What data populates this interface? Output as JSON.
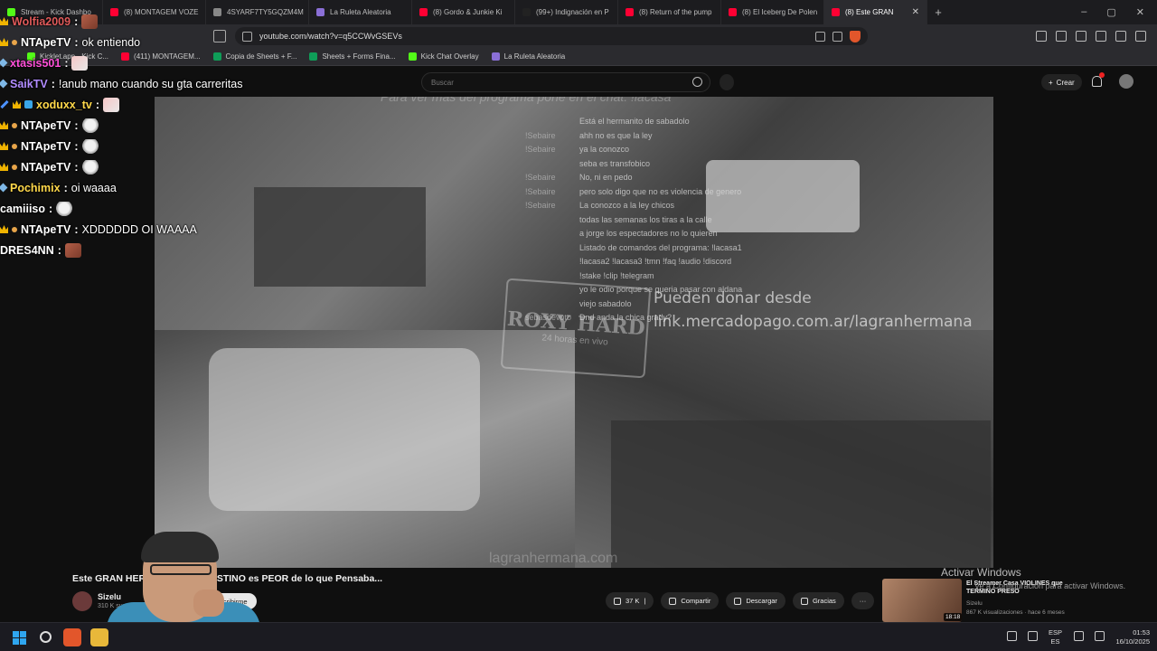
{
  "browser": {
    "tabs": [
      {
        "label": "Stream - Kick Dashbo",
        "color": "#53fc18"
      },
      {
        "label": "(8) MONTAGEM VOZE",
        "color": "#ff0033"
      },
      {
        "label": "4SYARF7TY5GQZM4M",
        "color": "#888888"
      },
      {
        "label": "La Ruleta Aleatoria",
        "color": "#8a6fd6"
      },
      {
        "label": "(8) Gordo & Junkie Ki",
        "color": "#ff0033"
      },
      {
        "label": "(99+) Indignación en P",
        "color": "#222222"
      },
      {
        "label": "(8) Return of the pump",
        "color": "#ff0033"
      },
      {
        "label": "(8) El Iceberg De Polen",
        "color": "#ff0033"
      },
      {
        "label": "(8) Este GRAN",
        "color": "#ff0033",
        "active": true
      }
    ],
    "new_tab_label": "Nueva pestaña",
    "url": "youtube.com/watch?v=q5CCWvGSEVs",
    "bookmarks": [
      {
        "label": "Kicklet.app - Kick C...",
        "color": "#53fc18"
      },
      {
        "label": "(411) MONTAGEM...",
        "color": "#ff0033"
      },
      {
        "label": "Copia de Sheets + F...",
        "color": "#0f9d58"
      },
      {
        "label": "Sheets + Forms Fina...",
        "color": "#0f9d58"
      },
      {
        "label": "Kick Chat Overlay",
        "color": "#53fc18"
      },
      {
        "label": "La Ruleta Aleatoria",
        "color": "#8a6fd6"
      }
    ]
  },
  "youtube": {
    "search_placeholder": "Buscar",
    "create_label": "Crear",
    "notification_count": "9"
  },
  "video": {
    "top_banner": "Para ver más del programa pone en el chat: !lacasa",
    "overlay_chat": [
      {
        "user": "",
        "text": "Está el hermanito de sabadolo"
      },
      {
        "user": "!Sebaire",
        "text": "ahh no es que la ley"
      },
      {
        "user": "!Sebaire",
        "text": "ya la conozco"
      },
      {
        "user": "",
        "text": "seba es transfobico"
      },
      {
        "user": "!Sebaire",
        "text": "No, ni en pedo"
      },
      {
        "user": "!Sebaire",
        "text": "pero solo digo que no es violencia de genero"
      },
      {
        "user": "!Sebaire",
        "text": "La conozco a la ley chicos"
      },
      {
        "user": "",
        "text": "todas las semanas los tiras a la calle"
      },
      {
        "user": "",
        "text": "a jorge los espectadores no lo quieren"
      },
      {
        "user": "",
        "text": "Listado de comandos del programa: !lacasa1"
      },
      {
        "user": "",
        "text": "!lacasa2 !lacasa3 !tmn !faq !audio !discord"
      },
      {
        "user": "",
        "text": "!stake !clip !telegram"
      },
      {
        "user": "",
        "text": "yo le odio porque se queria pasar con aldana"
      },
      {
        "user": "",
        "text": "viejo sabadolo"
      },
      {
        "user": "sebasdevoto",
        "text": "Dnd anda la chica grady?"
      }
    ],
    "stamp_title": "ROXY HARD",
    "stamp_sub": "24 horas en vivo",
    "donate_line1": "Pueden donar desde",
    "donate_line2": "link.mercadopago.com.ar/lagranhermana",
    "bottom_watermark": "lagranhermana.com"
  },
  "stream_chat": [
    {
      "user": "Wolfia2009",
      "text": "",
      "color": "#e05a5a",
      "badges": [
        "crown"
      ],
      "emote": "brown"
    },
    {
      "user": "NTApeTV",
      "text": "ok entiendo",
      "color": "#ffffff",
      "badges": [
        "crown",
        "dot"
      ],
      "emote": ""
    },
    {
      "user": "xtasis501",
      "text": "",
      "color": "#ff4fd8",
      "badges": [
        "diamond"
      ],
      "emote": "pink"
    },
    {
      "user": "SaikTV",
      "text": "!anub mano cuando su gta carreritas",
      "color": "#b18cff",
      "badges": [
        "diamond"
      ],
      "emote": ""
    },
    {
      "user": "xoduxx_tv",
      "text": "",
      "color": "#ffd84a",
      "badges": [
        "sword",
        "crown",
        "box"
      ],
      "emote": "pink"
    },
    {
      "user": "NTApeTV",
      "text": "",
      "color": "#ffffff",
      "badges": [
        "crown",
        "dot"
      ],
      "emote": "white"
    },
    {
      "user": "NTApeTV",
      "text": "",
      "color": "#ffffff",
      "badges": [
        "crown",
        "dot"
      ],
      "emote": "white"
    },
    {
      "user": "NTApeTV",
      "text": "",
      "color": "#ffffff",
      "badges": [
        "crown",
        "dot"
      ],
      "emote": "white"
    },
    {
      "user": "Pochimix",
      "text": "oi waaaa",
      "color": "#ffd84a",
      "badges": [
        "diamond"
      ],
      "emote": ""
    },
    {
      "user": "camiiiso",
      "text": "",
      "color": "#ffffff",
      "badges": [],
      "emote": "white"
    },
    {
      "user": "NTApeTV",
      "text": "XDDDDDD OI WAAAA",
      "color": "#ffffff",
      "badges": [
        "crown",
        "dot"
      ],
      "emote": ""
    },
    {
      "user": "DRES4NN",
      "text": "",
      "color": "#ffffff",
      "badges": [],
      "emote": "brown"
    }
  ],
  "video_info": {
    "title": "Este GRAN HERMANO CLANDESTINO es PEOR de lo que Pensaba...",
    "channel": "Sizelu",
    "subs": "310 K suscriptores",
    "subscribe_label": "Suscribirme",
    "likes": "37 K",
    "share_label": "Compartir",
    "download_label": "Descargar",
    "thanks_label": "Gracias"
  },
  "recommended": {
    "title": "El Streamer Casa VIOLINES que TERMINÓ PRESO",
    "channel": "Sizelu",
    "meta": "867 K visualizaciones · hace 6 meses",
    "duration": "18:18"
  },
  "windows": {
    "activate_title": "Activar Windows",
    "activate_sub": "Ve a Configuración para activar Windows.",
    "lang_top": "ESP",
    "lang_bottom": "ES",
    "time": "01:53",
    "date": "16/10/2025"
  }
}
